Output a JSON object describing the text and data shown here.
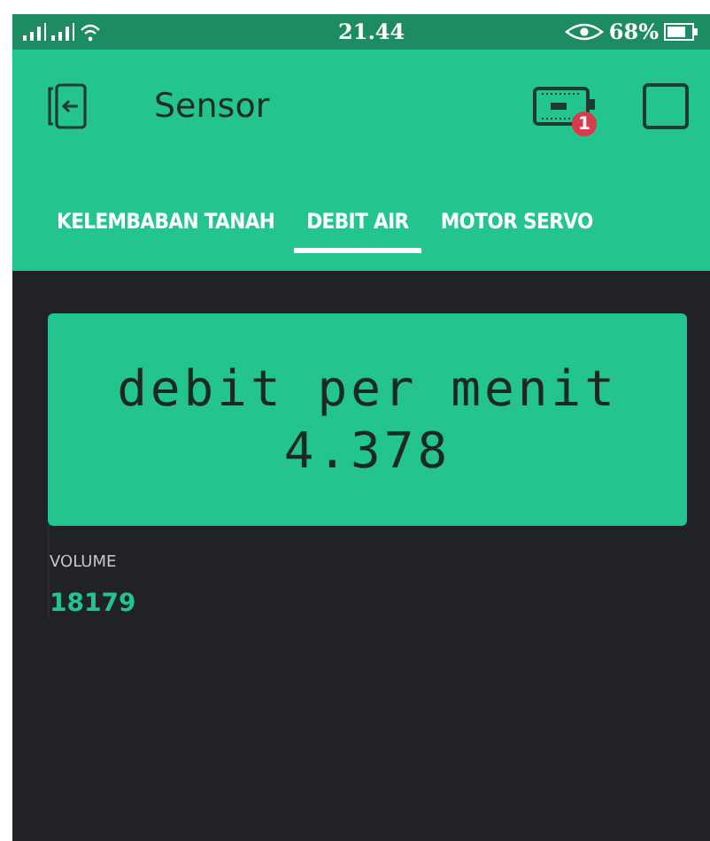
{
  "status_bar": {
    "time": "21.44",
    "battery": "68%"
  },
  "app_bar": {
    "title": "Sensor",
    "device_badge": "1"
  },
  "tabs": [
    {
      "label": "KELEMBABAN TANAH",
      "selected": false
    },
    {
      "label": "DEBIT AIR",
      "selected": true
    },
    {
      "label": "MOTOR SERVO",
      "selected": false
    }
  ],
  "lcd": {
    "lines": [
      "debit per menit",
      "4.378"
    ]
  },
  "value_display": {
    "label": "VOLUME",
    "value": "18179"
  }
}
